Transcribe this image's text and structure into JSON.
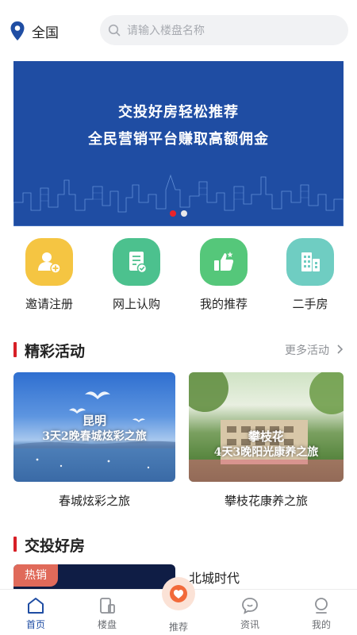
{
  "header": {
    "location": "全国",
    "search_placeholder": "请输入楼盘名称"
  },
  "banner": {
    "line1": "交投好房轻松推荐",
    "line2": "全民营销平台赚取高额佣金",
    "slide_count": 2,
    "active_slide": 1,
    "bg_color": "#1f4da3"
  },
  "quick_entries": [
    {
      "label": "邀请注册",
      "icon": "invite-user-icon",
      "color": "#f5c542"
    },
    {
      "label": "网上认购",
      "icon": "document-check-icon",
      "color": "#4cc18e"
    },
    {
      "label": "我的推荐",
      "icon": "thumbs-up-icon",
      "color": "#55c77a"
    },
    {
      "label": "二手房",
      "icon": "building-icon",
      "color": "#6fcdc2"
    }
  ],
  "activities": {
    "title": "精彩活动",
    "more": "更多活动",
    "items": [
      {
        "label": "春城炫彩之旅",
        "img_title": "昆明",
        "img_sub": "3天2晚春城炫彩之旅"
      },
      {
        "label": "攀枝花康养之旅",
        "img_title": "攀枝花",
        "img_sub": "4天3晚阳光康养之旅"
      }
    ]
  },
  "properties": {
    "title": "交投好房",
    "items": [
      {
        "badge": "热销",
        "name": "北城时代"
      }
    ]
  },
  "tabbar": {
    "items": [
      {
        "label": "首页",
        "icon": "home-icon",
        "active": true
      },
      {
        "label": "楼盘",
        "icon": "building-tab-icon",
        "active": false
      },
      {
        "label": "推荐",
        "icon": "heart-icon",
        "active": false
      },
      {
        "label": "资讯",
        "icon": "chat-bubble-icon",
        "active": false
      },
      {
        "label": "我的",
        "icon": "user-icon",
        "active": false
      }
    ]
  },
  "colors": {
    "accent": "#1f4da3",
    "section_bar": "#d71f26",
    "hot_badge": "#e06a5a"
  }
}
